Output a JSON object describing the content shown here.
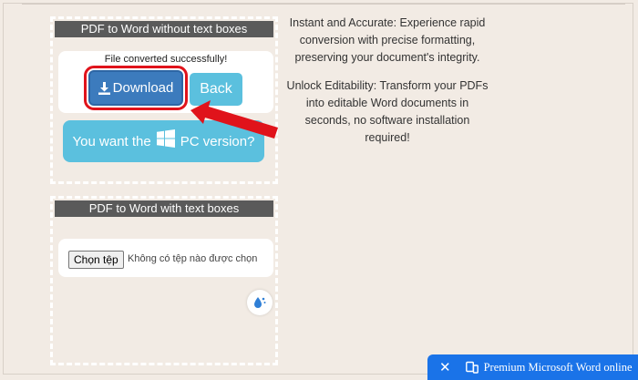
{
  "panel_top": {
    "header": "PDF to Word without text boxes",
    "success_message": "File converted successfully!",
    "download_label": "Download",
    "back_label": "Back",
    "pc_version_prefix": "You want the",
    "pc_version_suffix": "PC version?"
  },
  "panel_bottom": {
    "header": "PDF to Word with text boxes",
    "choose_file_label": "Chọn tệp",
    "no_file_text": "Không có tệp nào được chọn"
  },
  "description": {
    "paragraph1": "Instant and Accurate: Experience rapid conversion with precise formatting, preserving your document's integrity.",
    "paragraph2": "Unlock Editability: Transform your PDFs into editable Word documents in seconds, no software installation required!"
  },
  "promo_bar": {
    "close_glyph": "✕",
    "text": "Premium Microsoft Word online"
  },
  "icons": {
    "download": "download-icon",
    "windows": "windows-logo-icon",
    "drop": "water-drop-icon",
    "close": "close-icon",
    "device": "device-icon",
    "annotation_arrow": "red-arrow-annotation"
  },
  "colors": {
    "page_background": "#f2ebe4",
    "header_background": "#5a5a5a",
    "download_button": "#3c7bbd",
    "info_button": "#5bc0de",
    "annotation_red": "#e0131b",
    "promo_blue": "#1a73e8"
  }
}
